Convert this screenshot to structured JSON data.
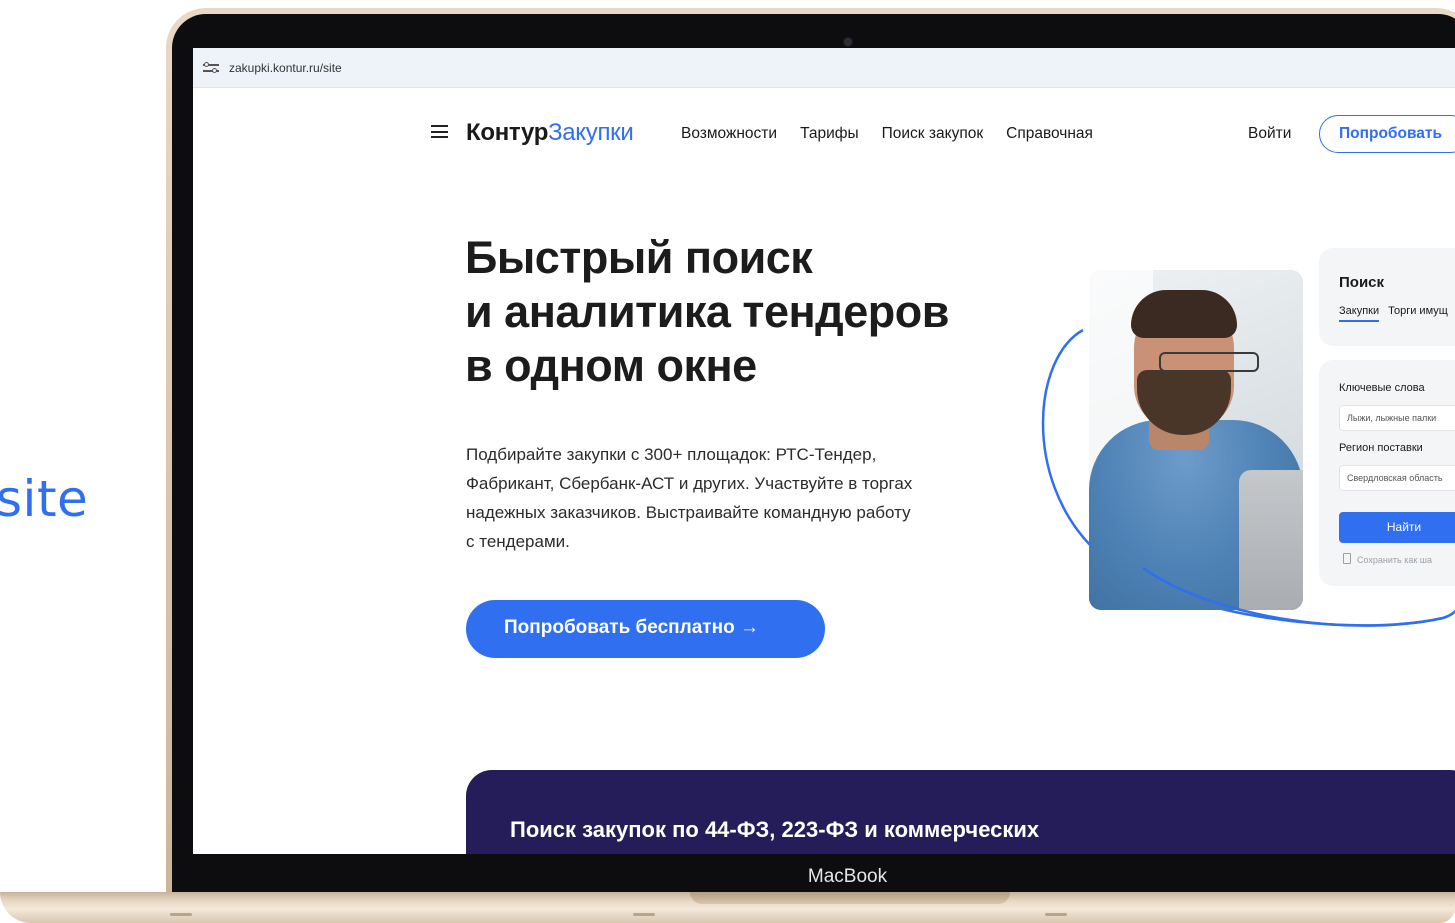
{
  "side_text": "site",
  "device": {
    "label": "MacBook"
  },
  "browser": {
    "url": "zakupki.kontur.ru/site"
  },
  "nav": {
    "logo_part1": "Контур",
    "logo_part2": "Закупки",
    "items": [
      {
        "label": "Возможности"
      },
      {
        "label": "Тарифы"
      },
      {
        "label": "Поиск закупок"
      },
      {
        "label": "Справочная"
      }
    ],
    "login_label": "Войти",
    "try_label": "Попробовать"
  },
  "hero": {
    "title_lines": [
      "Быстрый поиск",
      "и аналитика тендеров",
      "в одном окне"
    ],
    "desc_lines": [
      "Подбирайте закупки с 300+ площадок: РТС-Тендер,",
      "Фабрикант, Сбербанк-АСТ и других. Участвуйте в торгах",
      "надежных заказчиков. Выстраивайте командную работу",
      "с тендерами."
    ],
    "cta_label": "Попробовать бесплатно →"
  },
  "search_widget": {
    "title": "Поиск",
    "tab_active": "Закупки",
    "tab_other": "Торги имущ",
    "keywords_label": "Ключевые слова",
    "keywords_value": "Лыжи, лыжные палки",
    "region_label": "Регион поставки",
    "region_value": "Свердловская область",
    "find_label": "Найти",
    "save_label": "Сохранить как ша"
  },
  "banner": {
    "heading": "Поиск закупок по 44-ФЗ, 223-ФЗ и коммерческих"
  },
  "colors": {
    "accent": "#2f6ff0",
    "banner": "#251d5a",
    "text": "#1a1a1a"
  }
}
